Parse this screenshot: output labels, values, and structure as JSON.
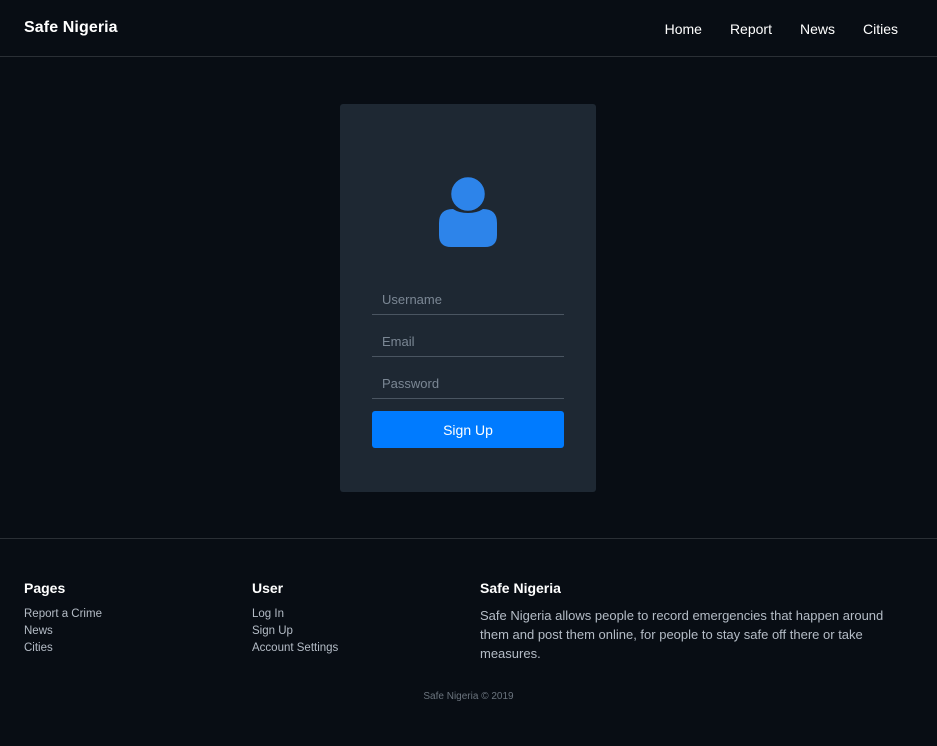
{
  "navbar": {
    "brand": "Safe Nigeria",
    "links": [
      "Home",
      "Report",
      "News",
      "Cities"
    ]
  },
  "form": {
    "avatar_icon": "user-icon",
    "accent_color": "#2d84ea",
    "fields": [
      {
        "placeholder": "Username",
        "value": ""
      },
      {
        "placeholder": "Email",
        "value": ""
      },
      {
        "placeholder": "Password",
        "value": ""
      }
    ],
    "submit_label": "Sign Up",
    "button_color": "#007bff"
  },
  "footer": {
    "pages": {
      "title": "Pages",
      "links": [
        "Report a Crime",
        "News",
        "Cities"
      ]
    },
    "user": {
      "title": "User",
      "links": [
        "Log In",
        "Sign Up",
        "Account Settings"
      ]
    },
    "about": {
      "title": "Safe Nigeria",
      "text": "Safe Nigeria allows people to record emergencies that happen around them and post them online, for people to stay safe off there or take measures."
    },
    "copyright": "Safe Nigeria © 2019"
  }
}
